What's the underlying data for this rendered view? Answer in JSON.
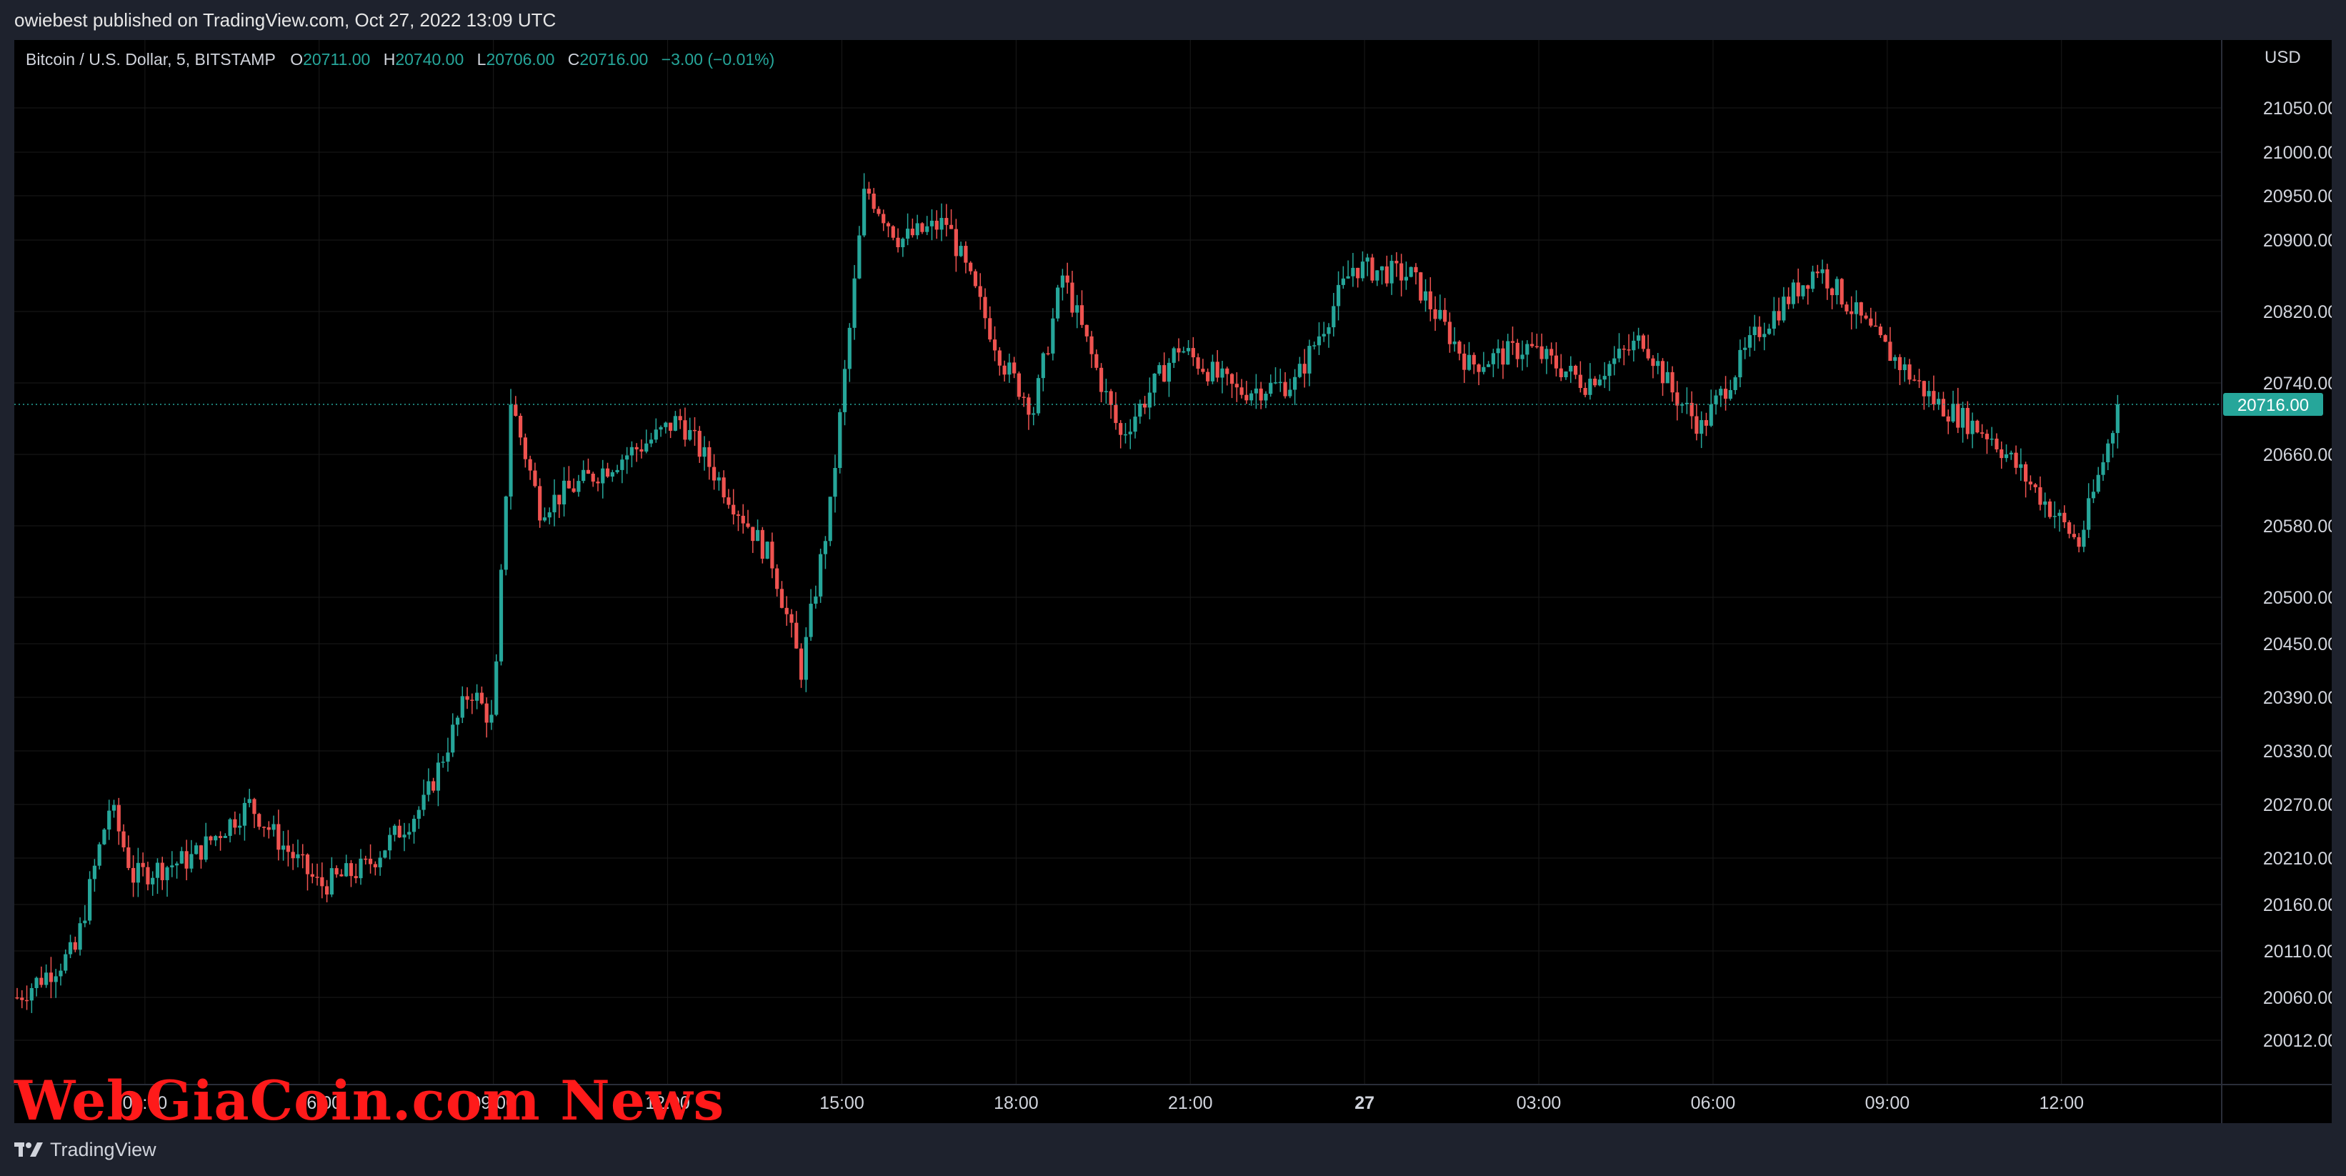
{
  "header": {
    "publish_note": "owiebest published on TradingView.com, Oct 27, 2022 13:09 UTC"
  },
  "legend": {
    "symbol": "Bitcoin / U.S. Dollar, 5, BITSTAMP",
    "open_key": "O",
    "open": "20711.00",
    "high_key": "H",
    "high": "20740.00",
    "low_key": "L",
    "low": "20706.00",
    "close_key": "C",
    "close": "20716.00",
    "change": "−3.00 (−0.01%)"
  },
  "footer": {
    "brand_icon": "tradingview-logo-icon",
    "brand_label": "TradingView"
  },
  "watermark": "WebGiaCoin.com News",
  "colors": {
    "up": "#26a69a",
    "down": "#ef5350",
    "background": "#000000",
    "chrome": "#1e222d",
    "grid": "#1a1a1a",
    "axis_text": "#d1d4dc"
  },
  "chart_data": {
    "type": "candlestick",
    "currency_label": "USD",
    "current_price": 20716.0,
    "current_price_label": "20716.00",
    "y_ticks": [
      21050,
      21000,
      20950,
      20900,
      20820,
      20740,
      20660,
      20580,
      20500,
      20450,
      20390,
      20330,
      20270,
      20210,
      20160,
      20110,
      20060,
      20012
    ],
    "y_tick_labels": [
      "21050.00",
      "21000.00",
      "20950.00",
      "20900.00",
      "20820.00",
      "20740.00",
      "20660.00",
      "20580.00",
      "20500.00",
      "20450.00",
      "20390.00",
      "20330.00",
      "20270.00",
      "20210.00",
      "20160.00",
      "20110.00",
      "20060.00",
      "20012.00"
    ],
    "x_ticks": [
      {
        "label": "03:00",
        "bold": false
      },
      {
        "label": "06:00",
        "bold": false
      },
      {
        "label": "09:00",
        "bold": false
      },
      {
        "label": "12:00",
        "bold": false
      },
      {
        "label": "15:00",
        "bold": false
      },
      {
        "label": "18:00",
        "bold": false
      },
      {
        "label": "21:00",
        "bold": false
      },
      {
        "label": "27",
        "bold": true
      },
      {
        "label": "03:00",
        "bold": false
      },
      {
        "label": "06:00",
        "bold": false
      },
      {
        "label": "09:00",
        "bold": false
      },
      {
        "label": "12:00",
        "bold": false
      }
    ],
    "path_hours": [
      0,
      1,
      1.6,
      2,
      3,
      4,
      4.5,
      5.2,
      6,
      7,
      7.8,
      8.2,
      8.5,
      9,
      10,
      11,
      11.4,
      12,
      13,
      13.5,
      14,
      14.6,
      15.2,
      16,
      17,
      17.5,
      18,
      19,
      20,
      21,
      22,
      23,
      24,
      25,
      26,
      27,
      28,
      28.5,
      29,
      30,
      31,
      32,
      33,
      34,
      35,
      35.5,
      36.2
    ],
    "path_prices": [
      20060,
      20110,
      20270,
      20190,
      20210,
      20270,
      20230,
      20180,
      20200,
      20270,
      20400,
      20360,
      20720,
      20600,
      20640,
      20680,
      20700,
      20640,
      20540,
      20420,
      20600,
      20960,
      20900,
      20920,
      20760,
      20710,
      20860,
      20680,
      20780,
      20730,
      20740,
      20870,
      20860,
      20760,
      20780,
      20740,
      20790,
      20730,
      20690,
      20800,
      20870,
      20790,
      20720,
      20680,
      20600,
      20560,
      20716
    ]
  }
}
